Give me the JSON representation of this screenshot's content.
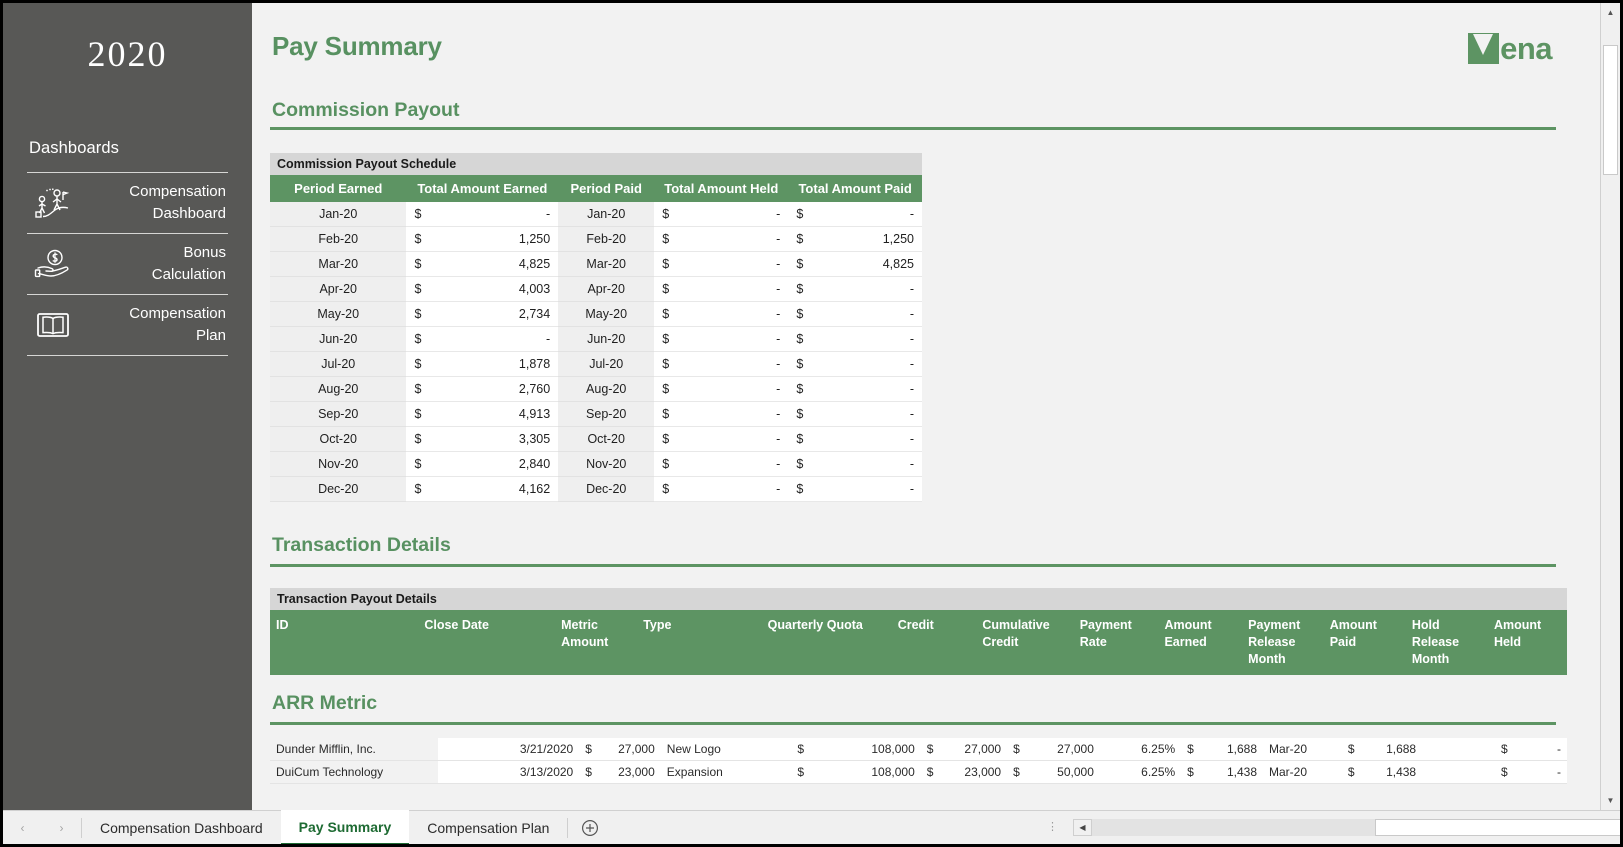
{
  "sidebar": {
    "year": "2020",
    "section_label": "Dashboards",
    "items": [
      {
        "label_line1": "Compensation",
        "label_line2": "Dashboard",
        "icon": "presentation-chart-people-icon"
      },
      {
        "label_line1": "Bonus",
        "label_line2": "Calculation",
        "icon": "hand-holding-dollar-icon"
      },
      {
        "label_line1": "Compensation",
        "label_line2": "Plan",
        "icon": "open-book-icon"
      }
    ]
  },
  "header": {
    "page_title": "Pay Summary",
    "logo_text": "ena",
    "brand_color": "#5d9463"
  },
  "sections": {
    "commission": "Commission Payout",
    "transaction": "Transaction Details",
    "arr": "ARR Metric"
  },
  "commission_table": {
    "caption": "Commission Payout Schedule",
    "columns": [
      "Period Earned",
      "Total Amount Earned",
      "Period Paid",
      "Total Amount Held",
      "Total Amount Paid"
    ],
    "rows": [
      {
        "period_earned": "Jan-20",
        "earned": "-",
        "period_paid": "Jan-20",
        "held": "-",
        "paid": "-"
      },
      {
        "period_earned": "Feb-20",
        "earned": "1,250",
        "period_paid": "Feb-20",
        "held": "-",
        "paid": "1,250"
      },
      {
        "period_earned": "Mar-20",
        "earned": "4,825",
        "period_paid": "Mar-20",
        "held": "-",
        "paid": "4,825"
      },
      {
        "period_earned": "Apr-20",
        "earned": "4,003",
        "period_paid": "Apr-20",
        "held": "-",
        "paid": "-"
      },
      {
        "period_earned": "May-20",
        "earned": "2,734",
        "period_paid": "May-20",
        "held": "-",
        "paid": "-"
      },
      {
        "period_earned": "Jun-20",
        "earned": "-",
        "period_paid": "Jun-20",
        "held": "-",
        "paid": "-"
      },
      {
        "period_earned": "Jul-20",
        "earned": "1,878",
        "period_paid": "Jul-20",
        "held": "-",
        "paid": "-"
      },
      {
        "period_earned": "Aug-20",
        "earned": "2,760",
        "period_paid": "Aug-20",
        "held": "-",
        "paid": "-"
      },
      {
        "period_earned": "Sep-20",
        "earned": "4,913",
        "period_paid": "Sep-20",
        "held": "-",
        "paid": "-"
      },
      {
        "period_earned": "Oct-20",
        "earned": "3,305",
        "period_paid": "Oct-20",
        "held": "-",
        "paid": "-"
      },
      {
        "period_earned": "Nov-20",
        "earned": "2,840",
        "period_paid": "Nov-20",
        "held": "-",
        "paid": "-"
      },
      {
        "period_earned": "Dec-20",
        "earned": "4,162",
        "period_paid": "Dec-20",
        "held": "-",
        "paid": "-"
      }
    ],
    "currency_symbol": "$"
  },
  "transaction_table": {
    "caption": "Transaction Payout Details",
    "columns": [
      "ID",
      "Close Date",
      "Metric Amount",
      "Type",
      "Quarterly Quota",
      "Credit",
      "Cumulative Credit",
      "Payment Rate",
      "Amount Earned",
      "Payment Release Month",
      "Amount Paid",
      "Hold Release Month",
      "Amount Held"
    ],
    "rows": [
      {
        "id": "Dunder Mifflin, Inc.",
        "close_date": "3/21/2020",
        "metric_amount": "27,000",
        "type": "New Logo",
        "quarterly_quota": "108,000",
        "credit": "27,000",
        "cumulative_credit": "27,000",
        "payment_rate": "6.25%",
        "amount_earned": "1,688",
        "payment_release_month": "Mar-20",
        "amount_paid": "1,688",
        "hold_release_month": "",
        "amount_held": "-"
      },
      {
        "id": "DuiCum Technology",
        "close_date": "3/13/2020",
        "metric_amount": "23,000",
        "type": "Expansion",
        "quarterly_quota": "108,000",
        "credit": "23,000",
        "cumulative_credit": "50,000",
        "payment_rate": "6.25%",
        "amount_earned": "1,438",
        "payment_release_month": "Mar-20",
        "amount_paid": "1,438",
        "hold_release_month": "",
        "amount_held": "-"
      }
    ],
    "currency_symbol": "$"
  },
  "sheet_tabs": {
    "tabs": [
      {
        "label": "Compensation Dashboard",
        "active": false
      },
      {
        "label": "Pay Summary",
        "active": true
      },
      {
        "label": "Compensation Plan",
        "active": false
      }
    ],
    "add_sheet_icon": "plus-circle-icon",
    "prev_icon": "‹",
    "next_icon": "›"
  }
}
